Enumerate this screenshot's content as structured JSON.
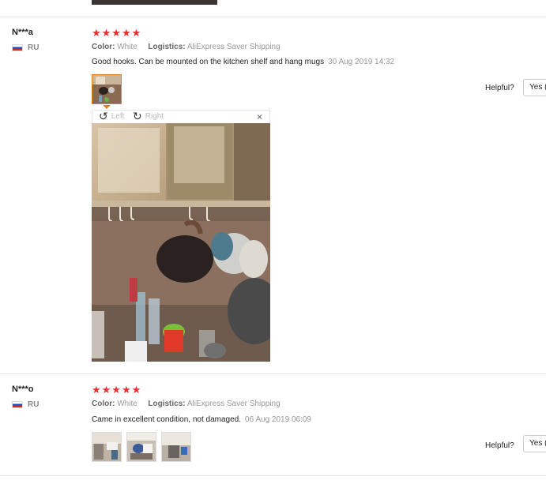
{
  "reviews": [
    {
      "reviewer": "N***a",
      "country": "RU",
      "stars": "★★★★★",
      "rating": 5,
      "color_label": "Color:",
      "color_value": "White",
      "logistics_label": "Logistics:",
      "logistics_value": "AliExpress Saver Shipping",
      "text": "Good hooks. Can be mounted on the kitchen shelf and hang mugs",
      "date": "30 Aug 2019 14:32",
      "helpful_label": "Helpful?",
      "yes_label": "Yes ("
    },
    {
      "reviewer": "N***o",
      "country": "RU",
      "stars": "★★★★★",
      "rating": 5,
      "color_label": "Color:",
      "color_value": "White",
      "logistics_label": "Logistics:",
      "logistics_value": "AliExpress Saver Shipping",
      "text": "Came in excellent condition, not damaged.",
      "date": "06 Aug 2019 06:09",
      "helpful_label": "Helpful?",
      "yes_label": "Yes ("
    }
  ],
  "viewer": {
    "left_label": "Left",
    "right_label": "Right",
    "rotate_left_icon": "↺",
    "rotate_right_icon": "↻",
    "close_icon": "×"
  },
  "colors": {
    "star": "#e62e2e",
    "active_thumb_border": "#e67e22",
    "divider": "#e8e8e8"
  }
}
